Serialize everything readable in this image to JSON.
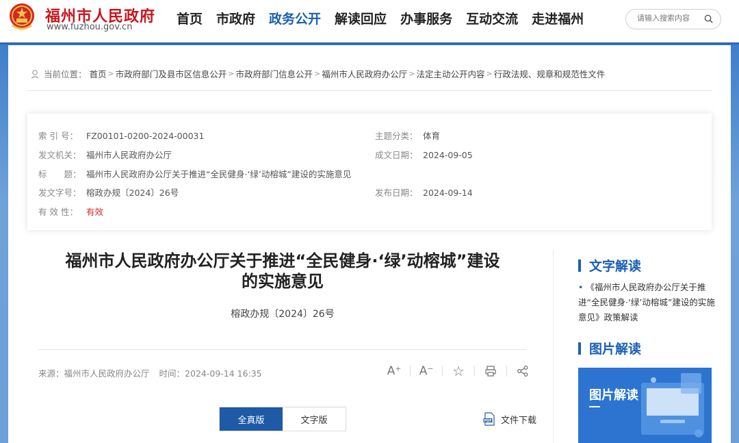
{
  "header": {
    "site_title": "福州市人民政府",
    "site_url": "www.fuzhou.gov.cn",
    "nav": [
      {
        "label": "首页",
        "active": false
      },
      {
        "label": "市政府",
        "active": false
      },
      {
        "label": "政务公开",
        "active": true
      },
      {
        "label": "解读回应",
        "active": false
      },
      {
        "label": "办事服务",
        "active": false
      },
      {
        "label": "互动交流",
        "active": false
      },
      {
        "label": "走进福州",
        "active": false
      }
    ],
    "search_placeholder": "请输入搜索内容",
    "accent_color": "#c8161d",
    "nav_active_color": "#1a5fb4"
  },
  "breadcrumb": {
    "label": "当前位置：",
    "items": [
      "首页",
      "市政府部门及县市区信息公开",
      "市政府部门信息公开",
      "福州市人民政府办公厅",
      "法定主动公开内容",
      "行政法规、规章和规范性文件"
    ]
  },
  "info": {
    "index_label": "索 引 号：",
    "index_value": "FZ00101-0200-2024-00031",
    "topic_label": "主题分类：",
    "topic_value": "体育",
    "issuer_label": "发文机关：",
    "issuer_value": "福州市人民政府办公厅",
    "written_label": "成文日期：",
    "written_value": "2024-09-05",
    "title_label": "标　　题：",
    "title_value": "福州市人民政府办公厅关于推进“全民健身·‘绿’动榕城”建设的实施意见",
    "docno_label": "发文字号：",
    "docno_value": "榕政办规〔2024〕26号",
    "published_label": "发布日期：",
    "published_value": "2024-09-14",
    "validity_label": "有 效 性：",
    "validity_value": "有效",
    "validity_color": "#d42a2a"
  },
  "article": {
    "title_line1": "福州市人民政府办公厅关于推进“全民健身·‘绿’动榕城”建设",
    "title_line2": "的实施意见",
    "doc_number": "榕政办规〔2024〕26号",
    "source_label": "来源：",
    "source_value": "福州市人民政府办公厅",
    "time_label": "时间：",
    "time_value": "2024-09-14 16:35",
    "tools": [
      {
        "icon": "font-increase-icon",
        "glyph": "A⁺"
      },
      {
        "icon": "font-decrease-icon",
        "glyph": "A⁻"
      },
      {
        "icon": "star-icon",
        "glyph": "☆"
      },
      {
        "icon": "print-icon",
        "glyph": ""
      },
      {
        "icon": "share-icon",
        "glyph": ""
      }
    ],
    "view_full": "全真版",
    "view_text": "文字版",
    "download_label": "文件下载"
  },
  "sidebar": {
    "text_interp_title": "文字解读",
    "text_interp_items": [
      "《福州市人民政府办公厅关于推进“全民健身·‘绿’动榕城”建设的实施意见》政策解读"
    ],
    "pic_interp_title": "图片解读",
    "pic_card_label": "图片解读"
  }
}
